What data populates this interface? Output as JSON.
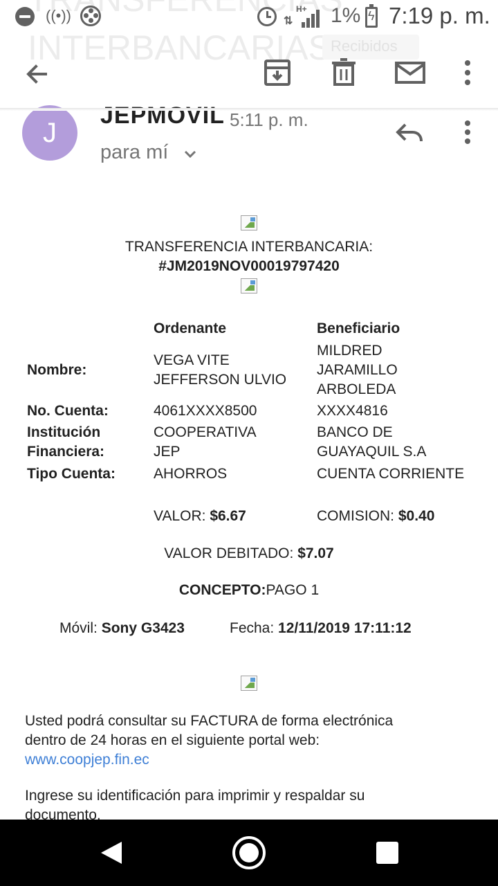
{
  "background_subject": {
    "line1": "TRANSFERENCIAS",
    "line2": "INTERBANCARIAS",
    "label_chip": "Recibidos"
  },
  "status_bar": {
    "battery_pct": "1%",
    "network_type": "H+",
    "time": "7:19 p. m."
  },
  "toolbar": {
    "icons": [
      "back-arrow-icon",
      "archive-icon",
      "delete-icon",
      "mail-icon",
      "more-vert-icon"
    ]
  },
  "message": {
    "avatar_letter": "J",
    "avatar_color": "#b39ddb",
    "sender": "JEPMOVIL",
    "time": "5:11 p. m.",
    "recipient": "para mí"
  },
  "email": {
    "title_line1": "TRANSFERENCIA INTERBANCARIA:",
    "title_line2": "#JM2019NOV00019797420",
    "table": {
      "headers": {
        "ordenante": "Ordenante",
        "beneficiario": "Beneficiario"
      },
      "rows": [
        {
          "label": [
            "Nombre:"
          ],
          "ordenante": [
            "VEGA VITE",
            "JEFFERSON ULVIO"
          ],
          "beneficiario": [
            "MILDRED",
            "JARAMILLO",
            "ARBOLEDA"
          ]
        },
        {
          "label": [
            "No. Cuenta:"
          ],
          "ordenante": [
            "4061XXXX8500"
          ],
          "beneficiario": [
            "XXXX4816"
          ]
        },
        {
          "label": [
            "Institución",
            "Financiera:"
          ],
          "ordenante": [
            "COOPERATIVA",
            "JEP"
          ],
          "beneficiario": [
            "BANCO DE",
            "GUAYAQUIL S.A"
          ]
        },
        {
          "label": [
            "Tipo Cuenta:"
          ],
          "ordenante": [
            "AHORROS"
          ],
          "beneficiario": [
            "CUENTA CORRIENTE"
          ]
        }
      ]
    },
    "valor_label": "VALOR: ",
    "valor": "$6.67",
    "comision_label": "COMISION: ",
    "comision": "$0.40",
    "debitado_label": "VALOR DEBITADO: ",
    "debitado": "$7.07",
    "concepto_label": "CONCEPTO:",
    "concepto": "PAGO 1",
    "movil_label": "Móvil: ",
    "movil": "Sony G3423",
    "fecha_label": "Fecha: ",
    "fecha": "12/11/2019 17:11:12",
    "factura_text_line1": "Usted podrá consultar su FACTURA de forma electrónica",
    "factura_text_line2": "dentro de 24 horas en el siguiente portal web:",
    "portal_link": "www.coopjep.fin.ec",
    "identificacion_line1": "Ingrese su identificación para imprimir y respaldar su",
    "identificacion_line2": "documento."
  },
  "nav_bar": {
    "icons": [
      "nav-back-icon",
      "nav-home-icon",
      "nav-recents-icon"
    ]
  }
}
